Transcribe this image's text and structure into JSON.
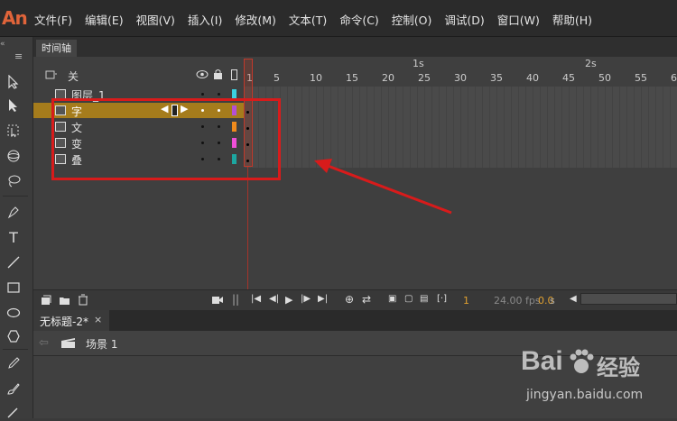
{
  "app": {
    "logo": "An"
  },
  "menubar": {
    "items": [
      "文件(F)",
      "编辑(E)",
      "视图(V)",
      "插入(I)",
      "修改(M)",
      "文本(T)",
      "命令(C)",
      "控制(O)",
      "调试(D)",
      "窗口(W)",
      "帮助(H)"
    ]
  },
  "timeline": {
    "tab_label": "时间轴",
    "header_label": "关",
    "layers": [
      {
        "name": "图层_1",
        "color": "#3ad0e0",
        "selected": false
      },
      {
        "name": "字",
        "color": "#b44fd6",
        "selected": true
      },
      {
        "name": "文",
        "color": "#f08a1c",
        "selected": false
      },
      {
        "name": "变",
        "color": "#f04fd8",
        "selected": false
      },
      {
        "name": "叠",
        "color": "#1ca6a0",
        "selected": false
      }
    ],
    "ruler": {
      "frame_numbers": [
        "1",
        "5",
        "10",
        "15",
        "20",
        "25",
        "30",
        "35",
        "40",
        "45",
        "50",
        "55",
        "6"
      ],
      "seconds": [
        "1s",
        "2s"
      ]
    },
    "footer": {
      "current_frame": "1",
      "fps": "24.00 fps",
      "time": "0.0",
      "time_unit": "s"
    }
  },
  "document": {
    "tab_title": "无标题-2*",
    "close_glyph": "×",
    "scene_label": "场景 1"
  },
  "watermark": {
    "brand": "Bai",
    "brand2": "经验",
    "url": "jingyan.baidu.com"
  },
  "colors": {
    "accent_red": "#d81b1b",
    "selected_row": "#a57c1c",
    "logo": "#e0643a"
  }
}
